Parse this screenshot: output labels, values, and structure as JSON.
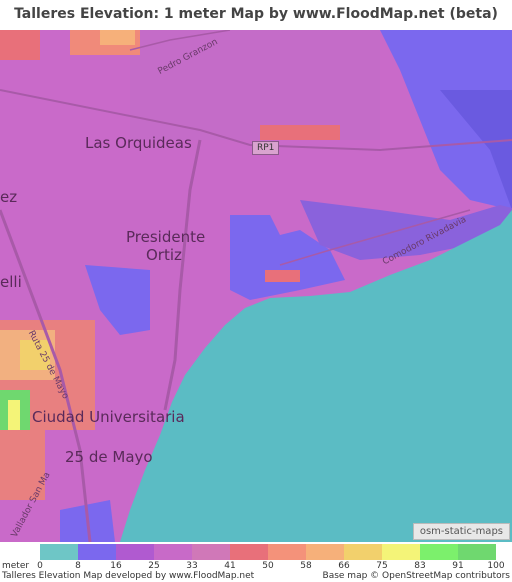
{
  "title": "Talleres Elevation: 1 meter Map by www.FloodMap.net (beta)",
  "places": {
    "las_orquideas": "Las Orquideas",
    "presidente": "Presidente",
    "ortiz": "Ortiz",
    "ciudad_universitaria": "Ciudad Universitaria",
    "veinticinco_de_mayo": "25 de Mayo",
    "ez": "ez",
    "elli": "elli"
  },
  "streets": {
    "pedro_granzon": "Pedro Granzon",
    "comodoro_rivadavia": "Comodoro Rivadavia",
    "ruta_25_de_mayo": "Ruta 25 de Mayo",
    "vallador_san_ma": "Vallador San Ma"
  },
  "road_badge": "RP1",
  "osm_badge": "osm-static-maps",
  "legend": {
    "unit": "meter",
    "ticks": [
      "0",
      "8",
      "16",
      "25",
      "33",
      "41",
      "50",
      "58",
      "66",
      "75",
      "83",
      "91",
      "100"
    ],
    "colors": [
      "#6ec6c6",
      "#7b68ee",
      "#b05ad0",
      "#c86ac8",
      "#d078b8",
      "#e8707a",
      "#f4927a",
      "#f6b07a",
      "#f2d06c",
      "#f4f478",
      "#7cf06c",
      "#6fd86f"
    ]
  },
  "footer": {
    "left": "Talleres Elevation Map developed by www.FloodMap.net",
    "right": "Base map © OpenStreetMap contributors"
  },
  "colors": {
    "sea": "#5bbcc4",
    "low": "#7b68ee",
    "mid": "#c96ac9",
    "high": "#f08080",
    "highest": "#5fd85f"
  }
}
